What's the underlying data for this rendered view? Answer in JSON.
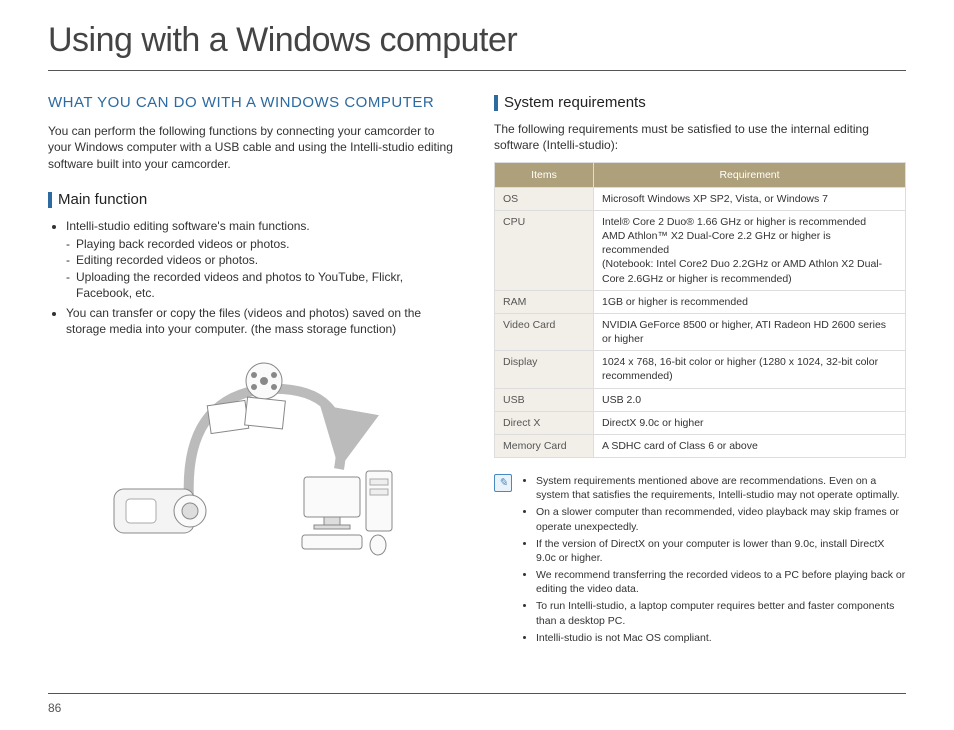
{
  "title": "Using with a Windows computer",
  "page_number": "86",
  "left": {
    "section_title": "WHAT YOU CAN DO WITH A WINDOWS COMPUTER",
    "intro": "You can perform the following functions by connecting your camcorder to your Windows computer with a USB cable and using the Intelli-studio editing software built into your camcorder.",
    "sub_title": "Main function",
    "b1": "Intelli-studio editing software's main functions.",
    "b1_d1": "Playing back recorded videos or photos.",
    "b1_d2": "Editing recorded videos or photos.",
    "b1_d3": "Uploading the recorded videos and photos to YouTube, Flickr, Facebook, etc.",
    "b2": "You can transfer or copy the files (videos and photos) saved on the storage media into your computer. (the mass storage function)"
  },
  "right": {
    "sub_title": "System requirements",
    "intro": "The following requirements must be satisfied to use the internal editing software (Intelli-studio):",
    "table": {
      "h1": "Items",
      "h2": "Requirement",
      "rows": [
        {
          "k": "OS",
          "v": "Microsoft Windows XP SP2, Vista, or Windows 7"
        },
        {
          "k": "CPU",
          "v": "Intel® Core 2 Duo® 1.66 GHz or higher is recommended\nAMD Athlon™ X2 Dual-Core 2.2 GHz or higher is recommended\n(Notebook: Intel Core2 Duo 2.2GHz or AMD Athlon X2 Dual-Core 2.6GHz or higher is recommended)"
        },
        {
          "k": "RAM",
          "v": "1GB or higher is recommended"
        },
        {
          "k": "Video Card",
          "v": "NVIDIA GeForce 8500 or higher, ATI Radeon HD 2600 series or higher"
        },
        {
          "k": "Display",
          "v": "1024 x 768, 16-bit color or higher (1280 x 1024, 32-bit color recommended)"
        },
        {
          "k": "USB",
          "v": "USB 2.0"
        },
        {
          "k": "Direct X",
          "v": "DirectX 9.0c or higher"
        },
        {
          "k": "Memory Card",
          "v": "A SDHC card of Class 6 or above"
        }
      ]
    },
    "notes": [
      "System requirements mentioned above are recommendations. Even on a system that satisfies the requirements, Intelli-studio may not operate optimally.",
      "On a slower computer than recommended, video playback may skip frames or operate unexpectedly.",
      "If the version of DirectX on your computer is lower than 9.0c, install DirectX 9.0c or higher.",
      "We recommend transferring the recorded videos to a PC before playing back or editing the video data.",
      "To run Intelli-studio, a laptop computer requires better and faster components than a desktop PC.",
      "Intelli-studio is not Mac OS compliant."
    ]
  }
}
